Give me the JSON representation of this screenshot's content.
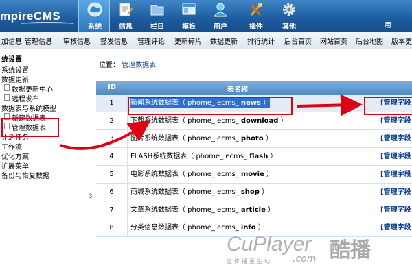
{
  "header": {
    "logo_text": "mpireCMS",
    "user_label": "用",
    "modules": [
      {
        "label": "系统",
        "icon": "globe-icon",
        "active": true
      },
      {
        "label": "信息",
        "icon": "document-edit-icon"
      },
      {
        "label": "栏目",
        "icon": "folder-icon"
      },
      {
        "label": "模板",
        "icon": "template-window-icon"
      },
      {
        "label": "用户",
        "icon": "user-icon"
      },
      {
        "label": "插件",
        "icon": "tools-icon"
      },
      {
        "label": "其他",
        "icon": "gear-icon"
      }
    ]
  },
  "nav": {
    "items": [
      "加信息",
      "管理信息",
      "审核信息",
      "签发信息",
      "管理评论",
      "更新碎片",
      "数据更新",
      "排行统计",
      "后台首页",
      "网站首页",
      "后台地图",
      "版本更"
    ]
  },
  "tree": {
    "items": [
      "统设置",
      "系统设置",
      "数据更新",
      "数据更新中心",
      "远程发布",
      "数据表与系统模型",
      "新建数据表",
      "管理数据表",
      "计划任务",
      "工作流",
      "优化方案",
      "扩展菜单",
      "备份与恢复数据"
    ]
  },
  "main": {
    "location_label": "位置：",
    "location_link": "管理数据表",
    "table": {
      "headers": {
        "id": "ID",
        "name": "表名称"
      },
      "rows": [
        {
          "id": "1",
          "name": "新闻系统数据表",
          "code_prefix": "（ phome_ ecms_ ",
          "code": "news",
          "code_suffix": " ）",
          "action": "[管理字段"
        },
        {
          "id": "2",
          "name": "下载系统数据表",
          "code_prefix": "（ phome_ ecms_ ",
          "code": "download",
          "code_suffix": " ）",
          "action": "[管理字段"
        },
        {
          "id": "3",
          "name": "图片系统数据表",
          "code_prefix": "（ phome_ ecms_ ",
          "code": "photo",
          "code_suffix": " ）",
          "action": "[管理字段"
        },
        {
          "id": "4",
          "name": "FLASH系统数据表",
          "code_prefix": "（ phome_ ecms_ ",
          "code": "flash",
          "code_suffix": " ）",
          "action": "[管理字段"
        },
        {
          "id": "5",
          "name": "电影系统数据表",
          "code_prefix": "（ phome_ ecms_ ",
          "code": "movie",
          "code_suffix": " ）",
          "action": "[管理字段"
        },
        {
          "id": "6",
          "name": "商城系统数据表",
          "code_prefix": "（ phome_ ecms_ ",
          "code": "shop",
          "code_suffix": " ）",
          "action": "[管理字段"
        },
        {
          "id": "7",
          "name": "文章系统数据表",
          "code_prefix": "（ phome_ ecms_ ",
          "code": "article",
          "code_suffix": " ）",
          "action": "[管理字段"
        },
        {
          "id": "8",
          "name": "分类信息数据表",
          "code_prefix": "（ phome_ ecms_ ",
          "code": "info",
          "code_suffix": " ）",
          "action": "[管理字段"
        }
      ]
    }
  },
  "watermark": {
    "main": "CuPlayer",
    "com": ".com",
    "cn": "酷播",
    "tagline": "让传播更生动"
  },
  "colors": {
    "annotation": "#e00014",
    "header_blue": "#1d5c9e",
    "link": "#0b3b8f"
  }
}
